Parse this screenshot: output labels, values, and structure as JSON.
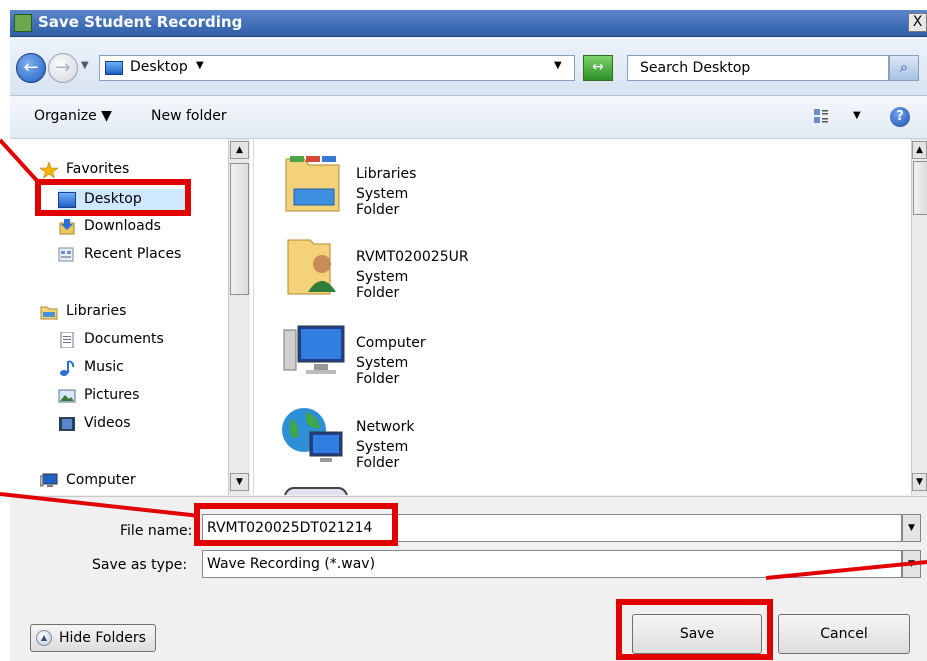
{
  "window": {
    "title": "Save Student Recording",
    "close_glyph": "X"
  },
  "navbar": {
    "back_glyph": "←",
    "forward_glyph": "→",
    "address": "Desktop",
    "address_caret": "▼",
    "dropdown_caret": "▼",
    "refresh_glyph": "↔",
    "search_placeholder": "Search Desktop",
    "search_glyph": "⌕"
  },
  "toolbar": {
    "organize": "Organize ▼",
    "new_folder": "New folder",
    "views_caret": "▼",
    "help_glyph": "?"
  },
  "nav_pane": {
    "items": [
      {
        "label": "Favorites",
        "icon": "star-icon"
      },
      {
        "label": "Desktop",
        "icon": "desktop-icon"
      },
      {
        "label": "Downloads",
        "icon": "downloads-icon"
      },
      {
        "label": "Recent Places",
        "icon": "recent-places-icon"
      },
      {
        "label": "Libraries",
        "icon": "libraries-icon"
      },
      {
        "label": "Documents",
        "icon": "documents-icon"
      },
      {
        "label": "Music",
        "icon": "music-icon"
      },
      {
        "label": "Pictures",
        "icon": "pictures-icon"
      },
      {
        "label": "Videos",
        "icon": "videos-icon"
      },
      {
        "label": "Computer",
        "icon": "computer-icon"
      }
    ],
    "scroll_up": "▲",
    "scroll_down": "▼"
  },
  "content": {
    "items": [
      {
        "name": "Libraries",
        "type": "System Folder",
        "icon": "libraries-folder-icon"
      },
      {
        "name": "RVMT020025UR",
        "type": "System Folder",
        "icon": "user-folder-icon"
      },
      {
        "name": "Computer",
        "type": "System Folder",
        "icon": "computer-icon"
      },
      {
        "name": "Network",
        "type": "System Folder",
        "icon": "network-icon"
      }
    ],
    "scroll_up": "▲",
    "scroll_down": "▼"
  },
  "form": {
    "file_name_label": "File name:",
    "file_name_value": "RVMT020025DT021214",
    "save_type_label": "Save as type:",
    "save_type_value": "Wave Recording (*.wav)",
    "drop_glyph": "▼"
  },
  "buttons": {
    "hide_folders": "Hide Folders",
    "hide_folders_glyph": "▲",
    "save": "Save",
    "cancel": "Cancel"
  },
  "colors": {
    "highlight": "#e00000",
    "title_bar": "#2f5ea8",
    "selection": "#cde8ff"
  }
}
